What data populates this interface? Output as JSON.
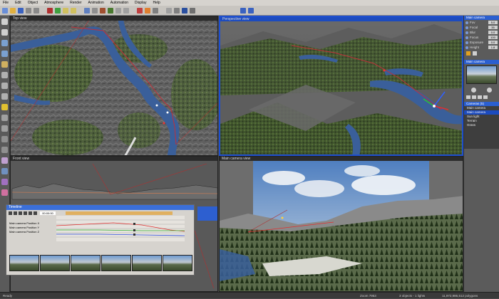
{
  "menu": [
    "File",
    "Edit",
    "Object",
    "Atmosphere",
    "Render",
    "Animation",
    "Automation",
    "Display",
    "Help"
  ],
  "viewports": {
    "top": "Top view",
    "perspective": "Perspective view",
    "front": "Front view",
    "main_camera": "Main camera view"
  },
  "camera_panel": {
    "header": "Main camera",
    "rows": [
      {
        "label": "Fov",
        "value": "5.0"
      },
      {
        "label": "Focal",
        "value": "35"
      },
      {
        "label": "Blur",
        "value": "0.0"
      },
      {
        "label": "Focus",
        "value": "100"
      },
      {
        "label": "Exposure",
        "value": "0.0"
      },
      {
        "label": "Height",
        "value": "1.8"
      }
    ],
    "preview_title": "Main camera",
    "tree_header": "Cameras (5)",
    "tree": [
      "Main camera",
      "Main camera",
      "Sun light",
      "Terrain",
      "Grass"
    ]
  },
  "timeline": {
    "title": "Timeline",
    "tracks": [
      "Main camera Position X",
      "Main camera Position Y",
      "Main camera Position Z"
    ],
    "time": "00:00:00"
  },
  "status": {
    "left": "Ready",
    "zoom": "Zoom 7953",
    "objects": "3 objects - 1 lights",
    "polygons": "11,972,986,512 polygons"
  },
  "colors": {
    "accent": "#1c4bbf",
    "water": "#3a5f9a",
    "terrain": "#5e5e5e",
    "vegetation": "#4d6b3a",
    "path": "#c0303a"
  }
}
